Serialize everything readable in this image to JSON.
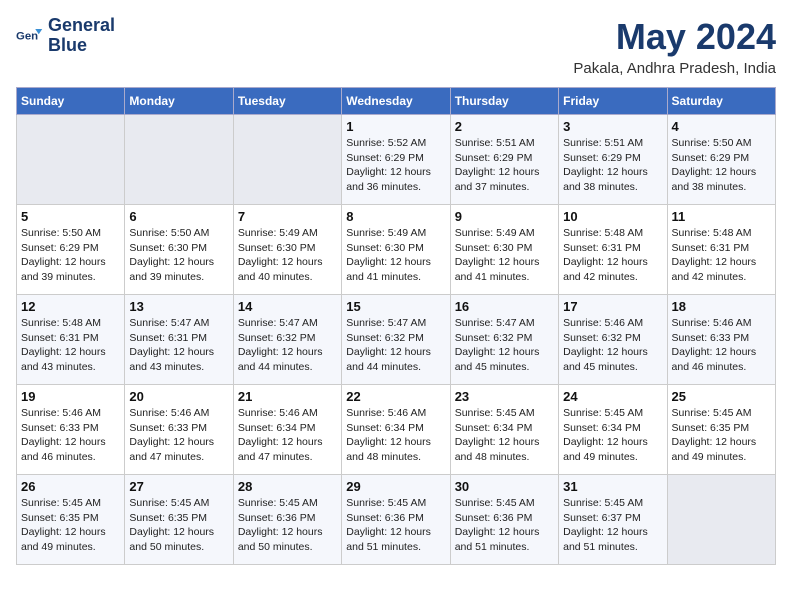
{
  "logo": {
    "line1": "General",
    "line2": "Blue"
  },
  "title": "May 2024",
  "subtitle": "Pakala, Andhra Pradesh, India",
  "days_header": [
    "Sunday",
    "Monday",
    "Tuesday",
    "Wednesday",
    "Thursday",
    "Friday",
    "Saturday"
  ],
  "weeks": [
    [
      {
        "num": "",
        "info": ""
      },
      {
        "num": "",
        "info": ""
      },
      {
        "num": "",
        "info": ""
      },
      {
        "num": "1",
        "info": "Sunrise: 5:52 AM\nSunset: 6:29 PM\nDaylight: 12 hours and 36 minutes."
      },
      {
        "num": "2",
        "info": "Sunrise: 5:51 AM\nSunset: 6:29 PM\nDaylight: 12 hours and 37 minutes."
      },
      {
        "num": "3",
        "info": "Sunrise: 5:51 AM\nSunset: 6:29 PM\nDaylight: 12 hours and 38 minutes."
      },
      {
        "num": "4",
        "info": "Sunrise: 5:50 AM\nSunset: 6:29 PM\nDaylight: 12 hours and 38 minutes."
      }
    ],
    [
      {
        "num": "5",
        "info": "Sunrise: 5:50 AM\nSunset: 6:29 PM\nDaylight: 12 hours and 39 minutes."
      },
      {
        "num": "6",
        "info": "Sunrise: 5:50 AM\nSunset: 6:30 PM\nDaylight: 12 hours and 39 minutes."
      },
      {
        "num": "7",
        "info": "Sunrise: 5:49 AM\nSunset: 6:30 PM\nDaylight: 12 hours and 40 minutes."
      },
      {
        "num": "8",
        "info": "Sunrise: 5:49 AM\nSunset: 6:30 PM\nDaylight: 12 hours and 41 minutes."
      },
      {
        "num": "9",
        "info": "Sunrise: 5:49 AM\nSunset: 6:30 PM\nDaylight: 12 hours and 41 minutes."
      },
      {
        "num": "10",
        "info": "Sunrise: 5:48 AM\nSunset: 6:31 PM\nDaylight: 12 hours and 42 minutes."
      },
      {
        "num": "11",
        "info": "Sunrise: 5:48 AM\nSunset: 6:31 PM\nDaylight: 12 hours and 42 minutes."
      }
    ],
    [
      {
        "num": "12",
        "info": "Sunrise: 5:48 AM\nSunset: 6:31 PM\nDaylight: 12 hours and 43 minutes."
      },
      {
        "num": "13",
        "info": "Sunrise: 5:47 AM\nSunset: 6:31 PM\nDaylight: 12 hours and 43 minutes."
      },
      {
        "num": "14",
        "info": "Sunrise: 5:47 AM\nSunset: 6:32 PM\nDaylight: 12 hours and 44 minutes."
      },
      {
        "num": "15",
        "info": "Sunrise: 5:47 AM\nSunset: 6:32 PM\nDaylight: 12 hours and 44 minutes."
      },
      {
        "num": "16",
        "info": "Sunrise: 5:47 AM\nSunset: 6:32 PM\nDaylight: 12 hours and 45 minutes."
      },
      {
        "num": "17",
        "info": "Sunrise: 5:46 AM\nSunset: 6:32 PM\nDaylight: 12 hours and 45 minutes."
      },
      {
        "num": "18",
        "info": "Sunrise: 5:46 AM\nSunset: 6:33 PM\nDaylight: 12 hours and 46 minutes."
      }
    ],
    [
      {
        "num": "19",
        "info": "Sunrise: 5:46 AM\nSunset: 6:33 PM\nDaylight: 12 hours and 46 minutes."
      },
      {
        "num": "20",
        "info": "Sunrise: 5:46 AM\nSunset: 6:33 PM\nDaylight: 12 hours and 47 minutes."
      },
      {
        "num": "21",
        "info": "Sunrise: 5:46 AM\nSunset: 6:34 PM\nDaylight: 12 hours and 47 minutes."
      },
      {
        "num": "22",
        "info": "Sunrise: 5:46 AM\nSunset: 6:34 PM\nDaylight: 12 hours and 48 minutes."
      },
      {
        "num": "23",
        "info": "Sunrise: 5:45 AM\nSunset: 6:34 PM\nDaylight: 12 hours and 48 minutes."
      },
      {
        "num": "24",
        "info": "Sunrise: 5:45 AM\nSunset: 6:34 PM\nDaylight: 12 hours and 49 minutes."
      },
      {
        "num": "25",
        "info": "Sunrise: 5:45 AM\nSunset: 6:35 PM\nDaylight: 12 hours and 49 minutes."
      }
    ],
    [
      {
        "num": "26",
        "info": "Sunrise: 5:45 AM\nSunset: 6:35 PM\nDaylight: 12 hours and 49 minutes."
      },
      {
        "num": "27",
        "info": "Sunrise: 5:45 AM\nSunset: 6:35 PM\nDaylight: 12 hours and 50 minutes."
      },
      {
        "num": "28",
        "info": "Sunrise: 5:45 AM\nSunset: 6:36 PM\nDaylight: 12 hours and 50 minutes."
      },
      {
        "num": "29",
        "info": "Sunrise: 5:45 AM\nSunset: 6:36 PM\nDaylight: 12 hours and 51 minutes."
      },
      {
        "num": "30",
        "info": "Sunrise: 5:45 AM\nSunset: 6:36 PM\nDaylight: 12 hours and 51 minutes."
      },
      {
        "num": "31",
        "info": "Sunrise: 5:45 AM\nSunset: 6:37 PM\nDaylight: 12 hours and 51 minutes."
      },
      {
        "num": "",
        "info": ""
      }
    ]
  ]
}
